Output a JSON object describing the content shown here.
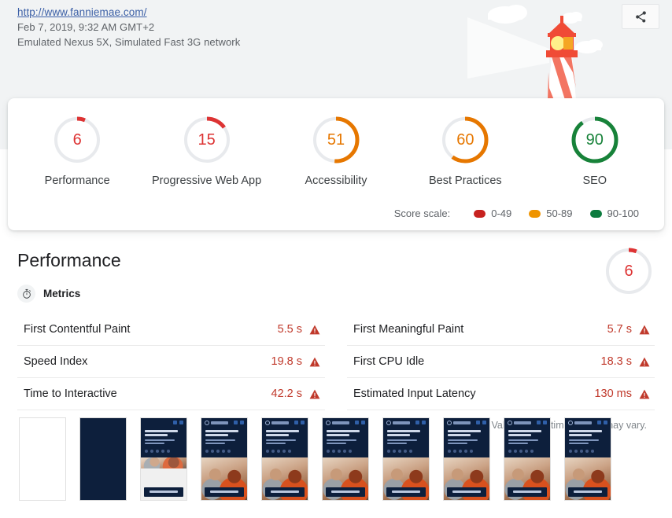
{
  "header": {
    "url": "http://www.fanniemae.com/",
    "timestamp": "Feb 7, 2019, 9:32 AM GMT+2",
    "environment": "Emulated Nexus 5X, Simulated Fast 3G network",
    "share_icon": "share-icon"
  },
  "scores": {
    "items": [
      {
        "label": "Performance",
        "value": "6",
        "score": 6,
        "color": "#d33",
        "band": "0-49"
      },
      {
        "label": "Progressive Web App",
        "value": "15",
        "score": 15,
        "color": "#d33",
        "band": "0-49"
      },
      {
        "label": "Accessibility",
        "value": "51",
        "score": 51,
        "color": "#e67700",
        "band": "50-89"
      },
      {
        "label": "Best Practices",
        "value": "60",
        "score": 60,
        "color": "#e67700",
        "band": "50-89"
      },
      {
        "label": "SEO",
        "value": "90",
        "score": 90,
        "color": "#178239",
        "band": "90-100"
      }
    ],
    "scale_label": "Score scale:",
    "scale": [
      {
        "range": "0-49",
        "color": "#c7221f"
      },
      {
        "range": "50-89",
        "color": "#ef9400"
      },
      {
        "range": "90-100",
        "color": "#0c7b3e"
      }
    ]
  },
  "performance": {
    "title": "Performance",
    "gauge_value": "6",
    "gauge_score": 6,
    "gauge_color": "#d33",
    "metrics_icon": "stopwatch-icon",
    "metrics_title": "Metrics",
    "metrics": [
      {
        "name": "First Contentful Paint",
        "value": "5.5 s",
        "status": "fail",
        "status_icon": "warning-triangle-icon",
        "color": "#c0392b"
      },
      {
        "name": "First Meaningful Paint",
        "value": "5.7 s",
        "status": "fail",
        "status_icon": "warning-triangle-icon",
        "color": "#c0392b"
      },
      {
        "name": "Speed Index",
        "value": "19.8 s",
        "status": "fail",
        "status_icon": "warning-triangle-icon",
        "color": "#c0392b"
      },
      {
        "name": "First CPU Idle",
        "value": "18.3 s",
        "status": "fail",
        "status_icon": "warning-triangle-icon",
        "color": "#c0392b"
      },
      {
        "name": "Time to Interactive",
        "value": "42.2 s",
        "status": "fail",
        "status_icon": "warning-triangle-icon",
        "color": "#c0392b"
      },
      {
        "name": "Estimated Input Latency",
        "value": "130 ms",
        "status": "fail",
        "status_icon": "warning-triangle-icon",
        "color": "#c0392b"
      }
    ],
    "estimated_note": "Values are estimated and may vary."
  },
  "filmstrip": {
    "frames": [
      {
        "state": "blank"
      },
      {
        "state": "dark"
      },
      {
        "state": "partial"
      },
      {
        "state": "loaded"
      },
      {
        "state": "loaded"
      },
      {
        "state": "loaded"
      },
      {
        "state": "loaded"
      },
      {
        "state": "loaded"
      },
      {
        "state": "loaded"
      },
      {
        "state": "loaded"
      }
    ]
  }
}
